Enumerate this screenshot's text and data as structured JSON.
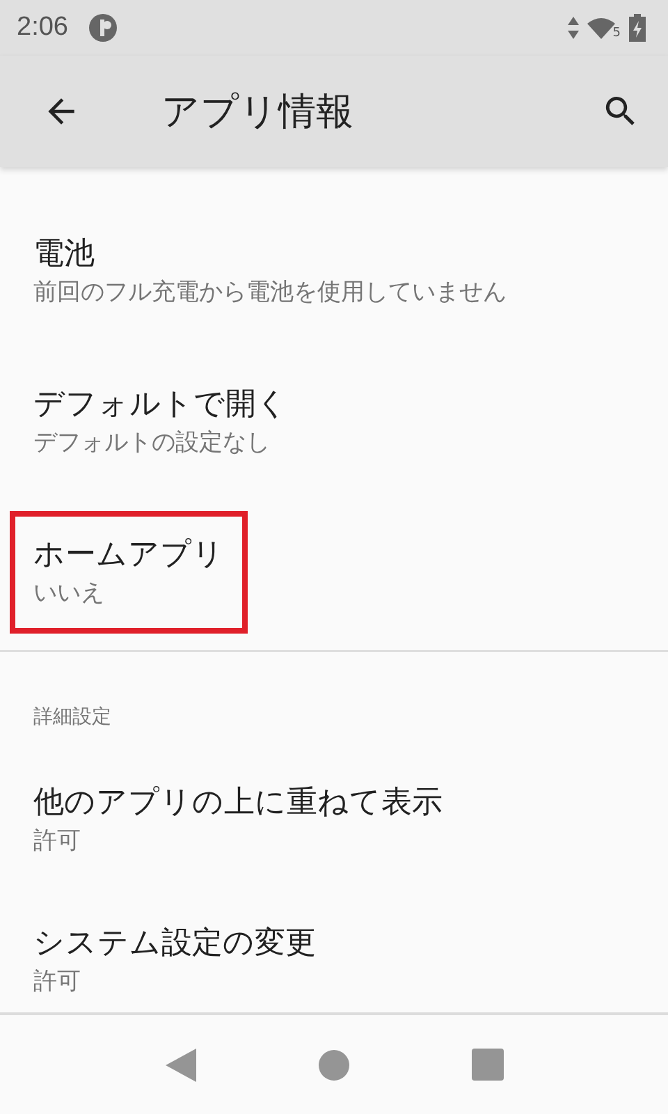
{
  "status_bar": {
    "time": "2:06",
    "wifi_badge": "5"
  },
  "toolbar": {
    "title": "アプリ情報"
  },
  "items": [
    {
      "title": "電池",
      "subtitle": "前回のフル充電から電池を使用していません",
      "highlighted": false
    },
    {
      "title": "デフォルトで開く",
      "subtitle": "デフォルトの設定なし",
      "highlighted": false
    },
    {
      "title": "ホームアプリ",
      "subtitle": "いいえ",
      "highlighted": true
    }
  ],
  "section": {
    "header": "詳細設定",
    "items": [
      {
        "title": "他のアプリの上に重ねて表示",
        "subtitle": "許可",
        "highlighted": false
      },
      {
        "title": "システム設定の変更",
        "subtitle": "許可",
        "highlighted": false
      }
    ]
  }
}
